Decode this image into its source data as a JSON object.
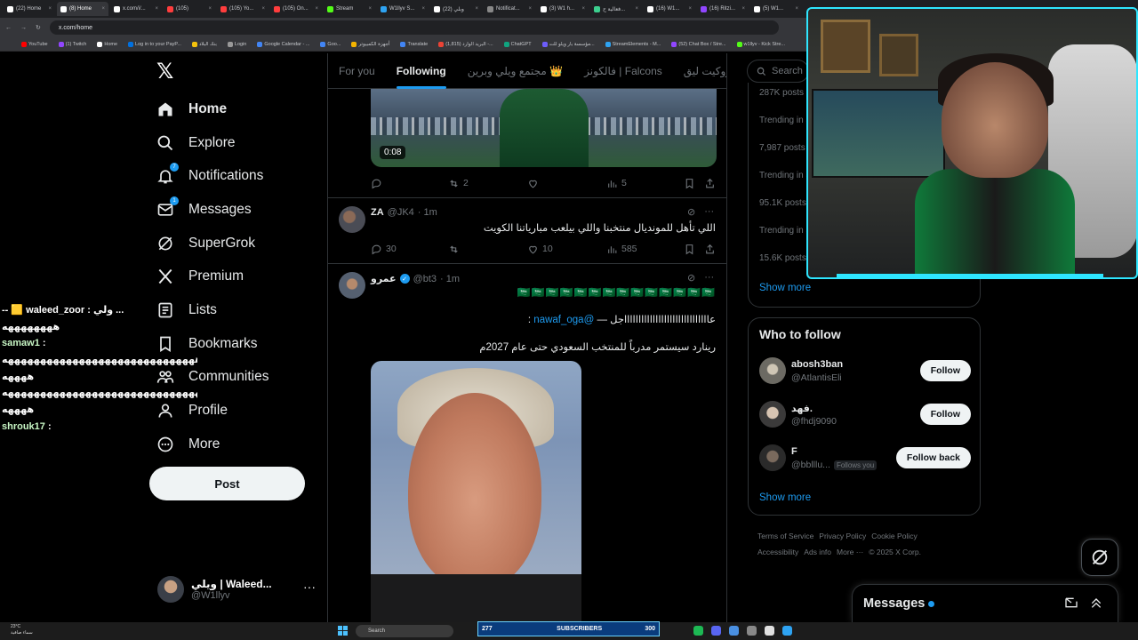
{
  "browser": {
    "tabs": [
      "(22) Home",
      "(8) Home",
      "x.com/i/...",
      "(105)",
      "(105) Yo...",
      "(105) On...",
      "Stream",
      "W1llyv S...",
      "(22) وبلي",
      "Notificat...",
      "(3) W1 h...",
      "فعالية ح...",
      "(16) W1...",
      "(16) Ritzi...",
      "(5) W1..."
    ],
    "active_tab": 1,
    "url": "x.com/home",
    "bookmarks": [
      "YouTube",
      "(1) Twitch",
      "Home",
      "Log in to your PayP...",
      "بنك البلاد",
      "Login",
      "Google Calendar - ...",
      "Goo...",
      "أجهزة الكمبيوتر",
      "Translate",
      "(1,815) البريد الوارد -...",
      "ChatGPT",
      "مؤسسة بار ويلو للت...",
      "StreamElements - M...",
      "(52) Chat Box / Stre...",
      "w1llyv - Kick Stre..."
    ]
  },
  "sidebar": {
    "items": [
      {
        "label": "Home",
        "icon": "home-icon"
      },
      {
        "label": "Explore",
        "icon": "search-icon"
      },
      {
        "label": "Notifications",
        "icon": "bell-icon",
        "badge": "7"
      },
      {
        "label": "Messages",
        "icon": "mail-icon",
        "badge": "1"
      },
      {
        "label": "SuperGrok",
        "icon": "grok-icon"
      },
      {
        "label": "Premium",
        "icon": "x-icon"
      },
      {
        "label": "Lists",
        "icon": "list-icon"
      },
      {
        "label": "Bookmarks",
        "icon": "bookmark-icon"
      },
      {
        "label": "Communities",
        "icon": "communities-icon"
      },
      {
        "label": "Profile",
        "icon": "profile-icon"
      },
      {
        "label": "More",
        "icon": "more-circle-icon"
      }
    ],
    "post_label": "Post",
    "account": {
      "name": "ويلي | Waleed...",
      "handle": "@W1llyv"
    }
  },
  "chat": {
    "lines": [
      {
        "user": "",
        "text": "-- 🟨 waleed_zoor : ولي ..."
      },
      {
        "user": "",
        "text": "ههههههههه"
      },
      {
        "user": "samaw1",
        "text": ""
      },
      {
        "user": "",
        "text": "ههههههههههههههههههههههههههههههه"
      },
      {
        "user": "",
        "text": "ههههه"
      },
      {
        "user": "",
        "text": "هههههههههههههههههههههههههههههههه"
      },
      {
        "user": "",
        "text": "ههههه"
      },
      {
        "user": "shrouk17",
        "text": ""
      }
    ]
  },
  "feed": {
    "tabs": [
      "For you",
      "Following",
      "مجتمع ويلي وبرين 👑",
      "فالكونز | Falcons",
      "روكيت ليق | RL"
    ],
    "active_tab": 1,
    "tweet1": {
      "timecode": "0:08",
      "replies": "",
      "reposts": "2",
      "likes": "",
      "views": "5"
    },
    "tweet2": {
      "name": "ZA",
      "handle": "@JK4",
      "time": "· 1m",
      "text": "اللي تأهل للمونديال منتخبنا واللي بيلعب مبارياتنا الكويت",
      "replies": "30",
      "reposts": "",
      "likes": "10",
      "views": "585"
    },
    "tweet3": {
      "name": "عمرو",
      "handle": "@bt3",
      "time": "· 1m",
      "flags": "🇸🇦🇸🇦🇸🇦🇸🇦🇸🇦🇸🇦🇸🇦🇸🇦🇸🇦🇸🇦🇸🇦🇸🇦🇸🇦🇸🇦",
      "line1_prefix": "عااااااااااااااااااااااااااااااجل — ",
      "mention": "@nawaf_oga",
      "line1_suffix": " :",
      "line2": "رينارد سيستمر مدرباً للمنتخب السعودي حتى عام 2027م"
    }
  },
  "right": {
    "search_placeholder": "Search",
    "trends": [
      {
        "text": "287K posts"
      },
      {
        "text": "Trending in S..."
      },
      {
        "text": "7,987 posts"
      },
      {
        "text": "Trending in S..."
      },
      {
        "text": "95.1K posts"
      },
      {
        "text": "Trending in S..."
      },
      {
        "text": "15.6K posts"
      }
    ],
    "show_more": "Show more",
    "who_to_follow": {
      "title": "Who to follow",
      "people": [
        {
          "name": "abosh3ban",
          "handle": "@AtlantisEli",
          "button": "Follow",
          "follows_you": ""
        },
        {
          "name": "فهد.",
          "handle": "@fhdj9090",
          "button": "Follow",
          "follows_you": ""
        },
        {
          "name": "F",
          "handle": "@bblllu...",
          "button": "Follow back",
          "follows_you": "Follows you"
        }
      ],
      "show_more": "Show more"
    },
    "footer": [
      "Terms of Service",
      "Privacy Policy",
      "Cookie Policy",
      "Accessibility",
      "Ads info",
      "More ···",
      "© 2025 X Corp."
    ]
  },
  "messages_drawer": {
    "label": "Messages"
  },
  "taskbar": {
    "temp": "23°C",
    "weather": "سماء صافية",
    "search": "Search",
    "subs_left": "277",
    "subs_label": "SUBSCRIBERS",
    "subs_right": "300"
  },
  "colors": {
    "accent": "#1d9bf0",
    "background": "#000000",
    "border": "#2f3336",
    "muted": "#71767b"
  }
}
